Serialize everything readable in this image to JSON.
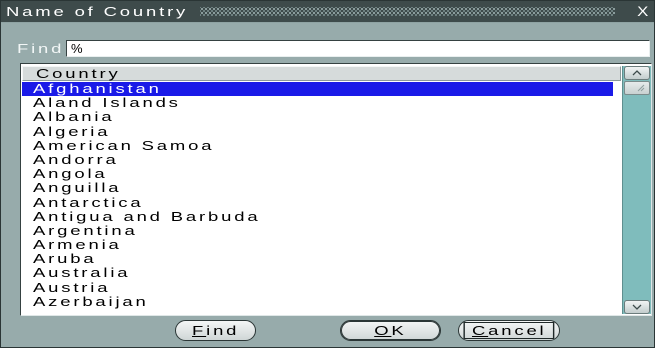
{
  "window": {
    "title": "Name of Country",
    "close_label": "X"
  },
  "find": {
    "label": "Find",
    "value": "%"
  },
  "list": {
    "column_header": "Country",
    "selected_index": 0,
    "rows": [
      "Afghanistan",
      "Aland Islands",
      "Albania",
      "Algeria",
      "American Samoa",
      "Andorra",
      "Angola",
      "Anguilla",
      "Antarctica",
      "Antigua and Barbuda",
      "Argentina",
      "Armenia",
      "Aruba",
      "Australia",
      "Austria",
      "Azerbaijan"
    ]
  },
  "scrollbar": {
    "position": 0
  },
  "buttons": {
    "find": {
      "label": "Find"
    },
    "ok": {
      "label": "OK",
      "default": true
    },
    "cancel": {
      "label": "Cancel",
      "focused": true
    }
  },
  "icons": {
    "close": "close-icon",
    "scroll_up": "chevron-up-icon",
    "scroll_down": "chevron-down-icon",
    "thumb_grip": "grip-icon"
  },
  "colors": {
    "title_bar": "#3e4b4b",
    "canvas": "#97abab",
    "selection": "#1a1ae8",
    "scroll_track": "#7fbcbc",
    "button_face": "#cfd6d6"
  }
}
